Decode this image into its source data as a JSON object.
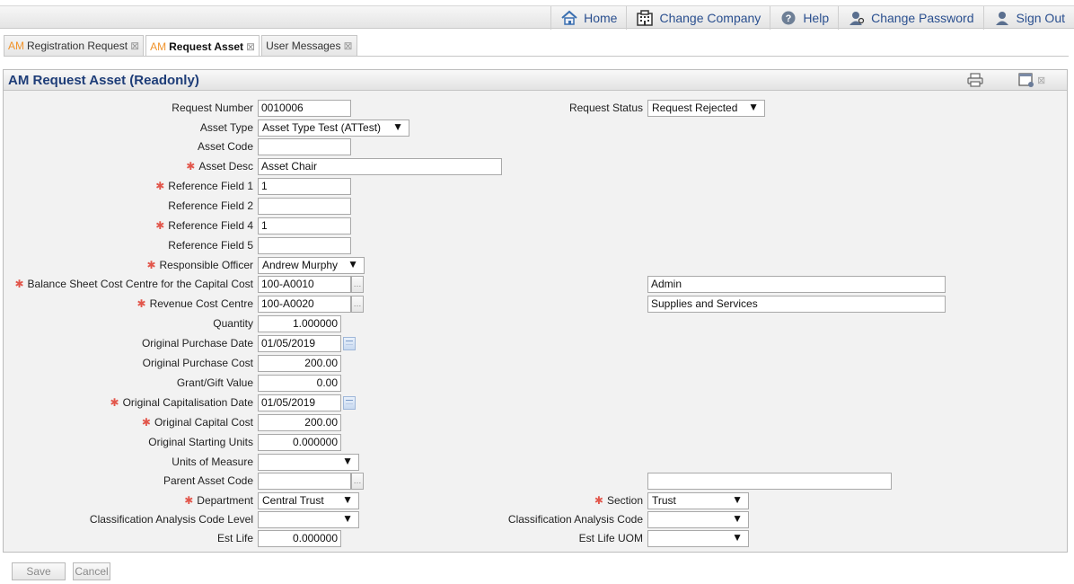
{
  "nav": {
    "home": "Home",
    "change_company": "Change Company",
    "help": "Help",
    "change_password": "Change Password",
    "sign_out": "Sign Out"
  },
  "tabs": [
    {
      "prefix": "AM",
      "label": "Registration Request",
      "active": false
    },
    {
      "prefix": "AM",
      "label": "Request Asset",
      "active": true
    },
    {
      "prefix": "",
      "label": "User Messages",
      "active": false
    }
  ],
  "panel": {
    "title": "AM Request Asset (Readonly)"
  },
  "form": {
    "request_number": {
      "label": "Request Number",
      "value": "0010006"
    },
    "request_status": {
      "label": "Request Status",
      "value": "Request Rejected"
    },
    "asset_type": {
      "label": "Asset Type",
      "value": "Asset Type Test (ATTest)"
    },
    "asset_code": {
      "label": "Asset Code",
      "value": ""
    },
    "asset_desc": {
      "label": "Asset Desc",
      "value": "Asset Chair"
    },
    "reference_field_1": {
      "label": "Reference Field 1",
      "value": "1"
    },
    "reference_field_2": {
      "label": "Reference Field 2",
      "value": ""
    },
    "reference_field_4": {
      "label": "Reference Field 4",
      "value": "1"
    },
    "reference_field_5": {
      "label": "Reference Field 5",
      "value": ""
    },
    "responsible_officer": {
      "label": "Responsible Officer",
      "value": "Andrew Murphy"
    },
    "balance_sheet_cc": {
      "label": "Balance Sheet Cost Centre for the Capital Cost",
      "value": "100-A0010",
      "desc": "Admin"
    },
    "revenue_cc": {
      "label": "Revenue Cost Centre",
      "value": "100-A0020",
      "desc": "Supplies and Services"
    },
    "quantity": {
      "label": "Quantity",
      "value": "1.000000"
    },
    "original_purchase_date": {
      "label": "Original Purchase Date",
      "value": "01/05/2019"
    },
    "original_purchase_cost": {
      "label": "Original Purchase Cost",
      "value": "200.00"
    },
    "grant_gift_value": {
      "label": "Grant/Gift Value",
      "value": "0.00"
    },
    "original_capitalisation_date": {
      "label": "Original Capitalisation Date",
      "value": "01/05/2019"
    },
    "original_capital_cost": {
      "label": "Original Capital Cost",
      "value": "200.00"
    },
    "original_starting_units": {
      "label": "Original Starting Units",
      "value": "0.000000"
    },
    "units_of_measure": {
      "label": "Units of Measure",
      "value": ""
    },
    "parent_asset_code": {
      "label": "Parent Asset Code",
      "value": "",
      "desc": ""
    },
    "department": {
      "label": "Department",
      "value": "Central Trust"
    },
    "section": {
      "label": "Section",
      "value": "Trust"
    },
    "classification_level": {
      "label": "Classification Analysis Code Level",
      "value": ""
    },
    "classification_code": {
      "label": "Classification Analysis Code",
      "value": ""
    },
    "est_life": {
      "label": "Est Life",
      "value": "0.000000"
    },
    "est_life_uom": {
      "label": "Est Life UOM",
      "value": ""
    }
  },
  "buttons": {
    "save": "Save",
    "cancel": "Cancel"
  },
  "colors": {
    "title_blue": "#1e3d78",
    "nav_link_blue": "#2a4f8f",
    "tab_prefix_orange": "#f0932b",
    "required_red": "#e2564b"
  },
  "icons": {
    "home": "house-icon",
    "change_company": "building-icon",
    "help": "question-icon",
    "change_password": "user-key-icon",
    "sign_out": "user-exit-icon",
    "print": "printer-icon",
    "window": "window-icon",
    "close": "close-icon",
    "calendar": "calendar-icon"
  }
}
